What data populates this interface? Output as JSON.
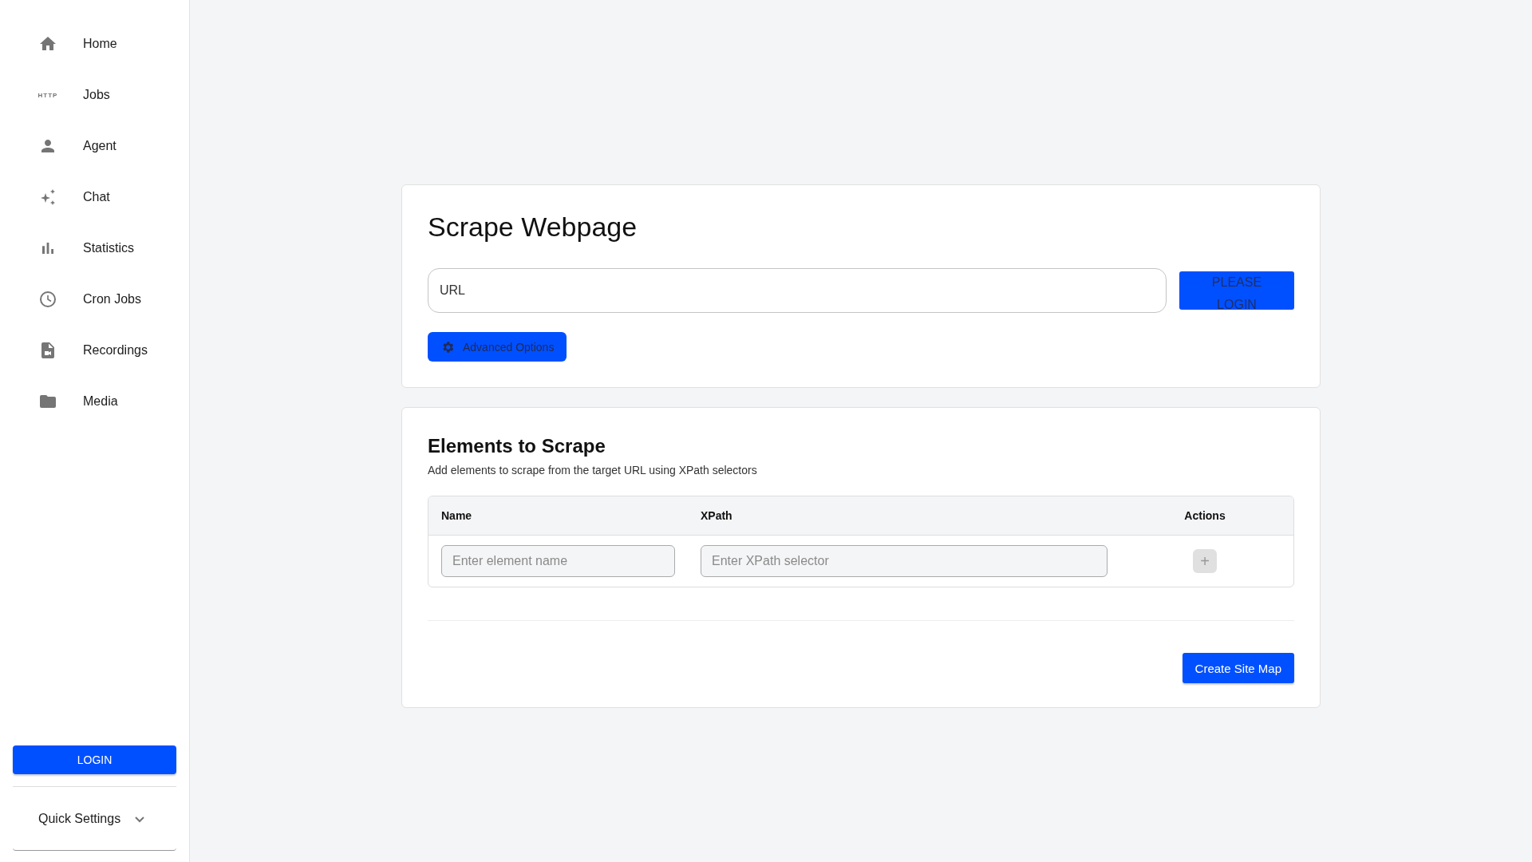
{
  "sidebar": {
    "items": [
      {
        "label": "Home",
        "kind": "home"
      },
      {
        "label": "Jobs",
        "kind": "http"
      },
      {
        "label": "Agent",
        "kind": "person"
      },
      {
        "label": "Chat",
        "kind": "sparkle"
      },
      {
        "label": "Statistics",
        "kind": "bars"
      },
      {
        "label": "Cron Jobs",
        "kind": "clock"
      },
      {
        "label": "Recordings",
        "kind": "file"
      },
      {
        "label": "Media",
        "kind": "folder"
      }
    ],
    "http_icon_text": "HTTP",
    "login_button": "LOGIN",
    "quick_settings": {
      "label": "Quick Settings",
      "expanded": false
    }
  },
  "scrape": {
    "title": "Scrape Webpage",
    "url_placeholder": "URL",
    "submit": {
      "label": "PLEASE LOGIN",
      "disabled": true
    },
    "advanced": "Advanced Options"
  },
  "elements": {
    "title": "Elements to Scrape",
    "subtitle": "Add elements to scrape from the target URL using XPath selectors",
    "columns": [
      "Name",
      "XPath",
      "Actions"
    ],
    "name_placeholder": "Enter element name",
    "xpath_placeholder": "Enter XPath selector",
    "add_button": {
      "label": "+",
      "disabled": true
    },
    "create_button": "Create Site Map"
  }
}
